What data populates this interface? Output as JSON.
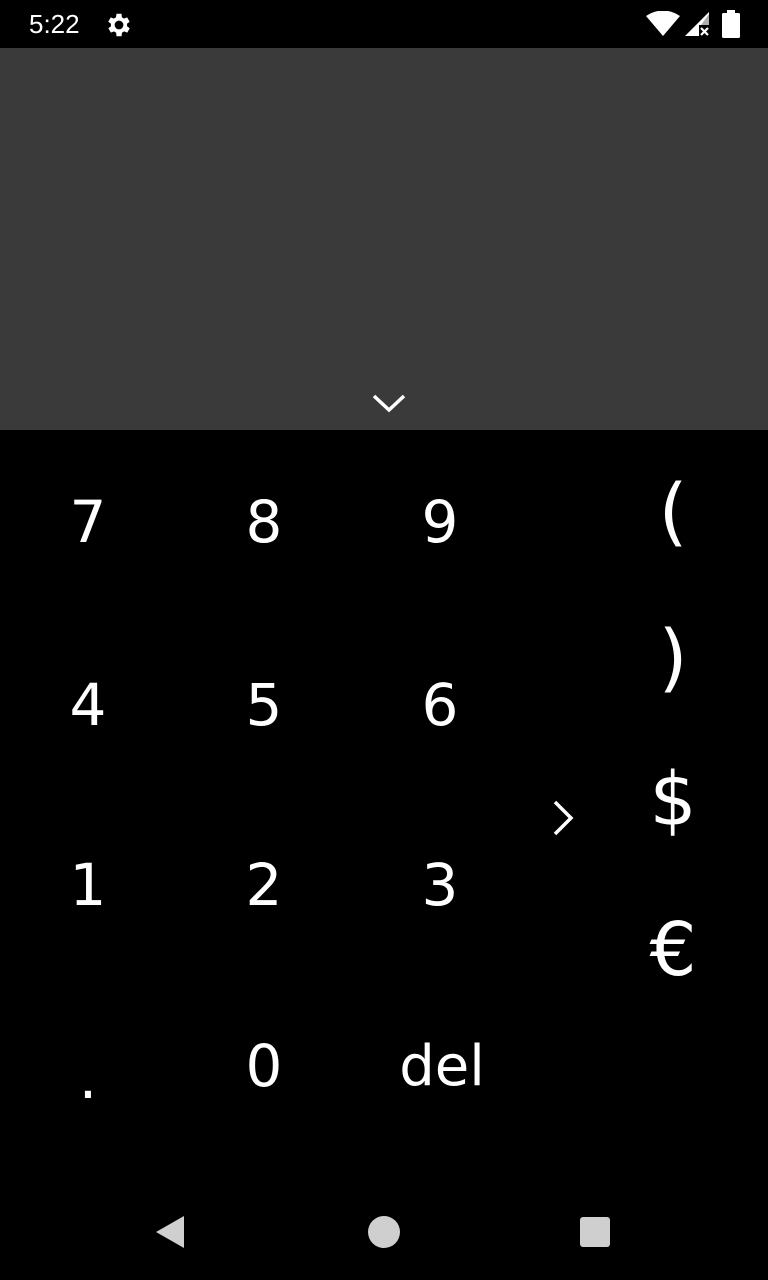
{
  "status_bar": {
    "time": "5:22",
    "icons": [
      "gear-icon",
      "wifi-icon",
      "signal-icon",
      "battery-icon"
    ]
  },
  "display": {
    "expression": "",
    "collapse_icon": "chevron-down-icon"
  },
  "keypad": {
    "rows": [
      [
        "7",
        "8",
        "9"
      ],
      [
        "4",
        "5",
        "6"
      ],
      [
        "1",
        "2",
        "3"
      ],
      [
        ".",
        "0",
        "del"
      ]
    ],
    "side_keys": [
      "(",
      ")",
      "$",
      "€"
    ],
    "expand_icon": "chevron-right-icon"
  },
  "nav_bar": {
    "icons": [
      "back-icon",
      "home-icon",
      "recents-icon"
    ]
  },
  "colors": {
    "display_bg": "#3a3a3a",
    "keypad_bg": "#000000",
    "text": "#ffffff",
    "nav_icon": "#cfcfcf"
  }
}
